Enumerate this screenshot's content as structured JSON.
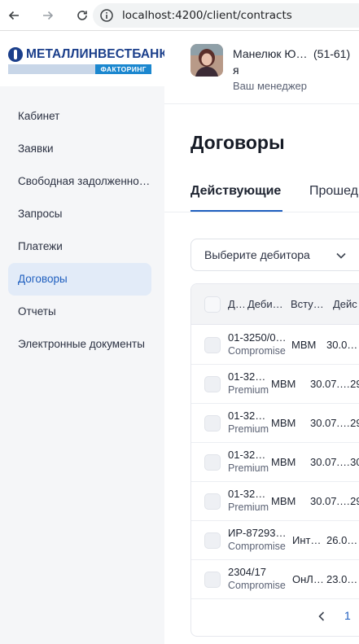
{
  "browser": {
    "url": "localhost:4200/client/contracts"
  },
  "brand": {
    "name": "МЕТАЛЛИНВЕСТБАНК",
    "sub": "ФАКТОРИНГ",
    "color": "#1b3f8b"
  },
  "sidebar": {
    "items": [
      {
        "label": "Кабинет"
      },
      {
        "label": "Заявки"
      },
      {
        "label": "Свободная задолженность"
      },
      {
        "label": "Запросы"
      },
      {
        "label": "Платежи"
      },
      {
        "label": "Договоры"
      },
      {
        "label": "Отчеты"
      },
      {
        "label": "Электронные документы"
      }
    ],
    "active_index": 5
  },
  "manager": {
    "name": "Манелюк Ю… я",
    "phone": "(51-61)",
    "role": "Ваш менеджер"
  },
  "page": {
    "title": "Договоры",
    "tabs": [
      {
        "label": "Действующие"
      },
      {
        "label": "Прошед"
      }
    ],
    "debtor_select": {
      "placeholder": "Выберите дебитора"
    }
  },
  "table": {
    "columns": [
      "Д…",
      "Деби…",
      "Всту…",
      "Дейс"
    ],
    "rows": [
      {
        "number": "01-3250/0…",
        "type": "Compromise",
        "debtor": "МВМ",
        "date": "30.0…"
      },
      {
        "number": "01-32…",
        "type": "Premium",
        "debtor": "МВМ",
        "date": "30.07.…29"
      },
      {
        "number": "01-32…",
        "type": "Premium",
        "debtor": "МВМ",
        "date": "30.07.…29"
      },
      {
        "number": "01-32…",
        "type": "Premium",
        "debtor": "МВМ",
        "date": "30.07.…30"
      },
      {
        "number": "01-32…",
        "type": "Premium",
        "debtor": "МВМ",
        "date": "30.07.…29"
      },
      {
        "number": "ИР-87293…",
        "type": "Compromise",
        "debtor": "Инте…",
        "date": "26.0…"
      },
      {
        "number": "2304/17",
        "type": "Compromise",
        "debtor": "ОнЛ…",
        "date": "23.0…"
      }
    ],
    "pager": {
      "current_page": "1"
    }
  },
  "colors": {
    "accent": "#1f5fbf",
    "sidebar_bg": "#f5f6f8",
    "active_item_bg": "#e2ebf8"
  }
}
